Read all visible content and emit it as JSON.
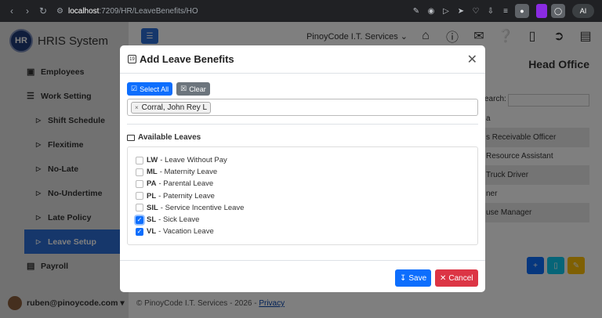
{
  "browser": {
    "url_host": "localhost",
    "url_path": ":7209/HR/LeaveBenefits/HO",
    "ai_label": "AI"
  },
  "sidebar": {
    "brand": "HRIS System",
    "logo_text": "HR",
    "items": [
      {
        "label": "Employees"
      },
      {
        "label": "Work Setting"
      },
      {
        "label": "Shift Schedule"
      },
      {
        "label": "Flexitime"
      },
      {
        "label": "No-Late"
      },
      {
        "label": "No-Undertime"
      },
      {
        "label": "Late Policy"
      },
      {
        "label": "Leave Setup"
      },
      {
        "label": "Payroll"
      }
    ],
    "user": "ruben@pinoycode.com"
  },
  "topbar": {
    "company": "PinoyCode I.T. Services"
  },
  "background": {
    "page_title": "Head Office",
    "search_label": "earch:",
    "rows": [
      "a",
      "s Receivable Officer",
      "Resource Assistant",
      "Truck Driver",
      "ner",
      "use Manager"
    ]
  },
  "footer": {
    "text": "© PinoyCode I.T. Services - 2026 - ",
    "link": "Privacy"
  },
  "modal": {
    "title": "Add Leave Benefits",
    "select_all": "Select All",
    "clear": "Clear",
    "selected_employee": "Corral, John Rey L",
    "available_label": "Available Leaves",
    "leaves": [
      {
        "code": "LW",
        "name": "- Leave Without Pay",
        "checked": false
      },
      {
        "code": "ML",
        "name": "- Maternity Leave",
        "checked": false
      },
      {
        "code": "PA",
        "name": "- Parental Leave",
        "checked": false
      },
      {
        "code": "PL",
        "name": "- Paternity Leave",
        "checked": false
      },
      {
        "code": "SIL",
        "name": "- Service Incentive Leave",
        "checked": false
      },
      {
        "code": "SL",
        "name": "- Sick Leave",
        "checked": true
      },
      {
        "code": "VL",
        "name": "- Vacation Leave",
        "checked": true
      }
    ],
    "save_label": "Save",
    "cancel_label": "Cancel"
  },
  "colors": {
    "primary": "#0d6efd",
    "danger": "#dc3545",
    "sidebar_active": "#2d6fd6"
  }
}
